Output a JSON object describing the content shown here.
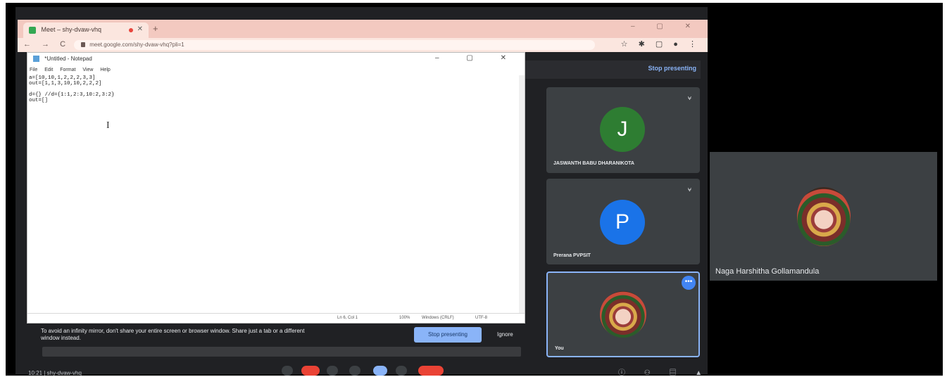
{
  "browser": {
    "tab_title": "Meet – shy-dvaw-vhq",
    "url": "meet.google.com/shy-dvaw-vhq?pli=1",
    "new_tab": "+",
    "window_controls": "– ▢ ✕",
    "nav_controls": "← → C",
    "extensions": "☆ ✱ ▢ ● ⋮"
  },
  "meet_header": {
    "stop_presenting": "Stop presenting"
  },
  "notepad": {
    "title": "*Untitled - Notepad",
    "window_controls": "– ▢ ✕",
    "menu": [
      "File",
      "Edit",
      "Format",
      "View",
      "Help"
    ],
    "content": "a=[10,10,1,2,2,2,3,3]\nout=[1,1,3,10,10,2,2,2]\n\nd={} //d={1:1,2:3,10:2,3:2}\nout=[]",
    "cursor": "I",
    "status": {
      "position": "Ln 6, Col 1",
      "zoom": "100%",
      "line_ending": "Windows (CRLF)",
      "encoding": "UTF-8"
    }
  },
  "share_warning": {
    "message": "To avoid an infinity mirror, don't share your entire screen or browser window. Share just a tab or a different window instead.",
    "stop_button": "Stop presenting",
    "ignore_button": "Ignore"
  },
  "footer": {
    "time_meeting": "10:21 | shy-dvaw-vhq"
  },
  "participants": [
    {
      "initial": "J",
      "name": "JASWANTH BABU DHARANIKOTA",
      "color": "#2e7d32"
    },
    {
      "initial": "P",
      "name": "Prerana PVPSIT",
      "color": "#1a73e8"
    },
    {
      "name": "You"
    }
  ],
  "more_options": "•••",
  "pinned": {
    "name": "Naga Harshitha Gollamandula"
  }
}
